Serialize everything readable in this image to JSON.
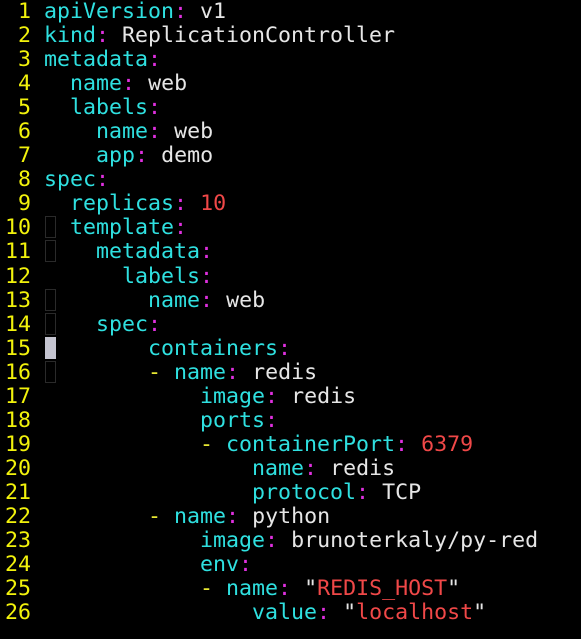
{
  "editor": {
    "colors": {
      "line_number": "#f2f20c",
      "key": "#2fe0e0",
      "colon": "#e030e0",
      "dash": "#e8e832",
      "value": "#e6e6e6",
      "number": "#f04848",
      "string": "#f04848",
      "cursor": "#c4c4d0"
    },
    "lines": [
      {
        "n": "1",
        "indent": 0,
        "key": "apiVersion",
        "value": "v1",
        "type": "plain"
      },
      {
        "n": "2",
        "indent": 0,
        "key": "kind",
        "value": "ReplicationController",
        "type": "plain"
      },
      {
        "n": "3",
        "indent": 0,
        "key": "metadata"
      },
      {
        "n": "4",
        "indent": 2,
        "key": "name",
        "value": "web",
        "type": "plain"
      },
      {
        "n": "5",
        "indent": 2,
        "key": "labels"
      },
      {
        "n": "6",
        "indent": 4,
        "key": "name",
        "value": "web",
        "type": "plain"
      },
      {
        "n": "7",
        "indent": 4,
        "key": "app",
        "value": "demo",
        "type": "plain"
      },
      {
        "n": "8",
        "indent": 0,
        "key": "spec"
      },
      {
        "n": "9",
        "indent": 2,
        "key": "replicas",
        "value": "10",
        "type": "num"
      },
      {
        "n": "10",
        "indent": 2,
        "key": "template",
        "marker": "box"
      },
      {
        "n": "11",
        "indent": 4,
        "key": "metadata",
        "marker": "box"
      },
      {
        "n": "12",
        "indent": 6,
        "key": "labels"
      },
      {
        "n": "13",
        "indent": 8,
        "key": "name",
        "value": "web",
        "type": "plain",
        "marker": "box"
      },
      {
        "n": "14",
        "indent": 4,
        "key": "spec",
        "marker": "box"
      },
      {
        "n": "15",
        "indent": 8,
        "key": "containers",
        "marker": "cursor"
      },
      {
        "n": "16",
        "indent": 10,
        "dash": true,
        "key": "name",
        "value": "redis",
        "type": "plain",
        "marker": "box"
      },
      {
        "n": "17",
        "indent": 12,
        "key": "image",
        "value": "redis",
        "type": "plain"
      },
      {
        "n": "18",
        "indent": 12,
        "key": "ports"
      },
      {
        "n": "19",
        "indent": 14,
        "dash": true,
        "key": "containerPort",
        "value": "6379",
        "type": "num"
      },
      {
        "n": "20",
        "indent": 16,
        "key": "name",
        "value": "redis",
        "type": "plain"
      },
      {
        "n": "21",
        "indent": 16,
        "key": "protocol",
        "value": "TCP",
        "type": "plain"
      },
      {
        "n": "22",
        "indent": 10,
        "dash": true,
        "key": "name",
        "value": "python",
        "type": "plain"
      },
      {
        "n": "23",
        "indent": 12,
        "key": "image",
        "value": "brunoterkaly/py-red",
        "type": "plain"
      },
      {
        "n": "24",
        "indent": 12,
        "key": "env"
      },
      {
        "n": "25",
        "indent": 14,
        "dash": true,
        "key": "name",
        "value": "REDIS_HOST",
        "type": "str"
      },
      {
        "n": "26",
        "indent": 16,
        "key": "value",
        "value": "localhost",
        "type": "str"
      }
    ]
  }
}
